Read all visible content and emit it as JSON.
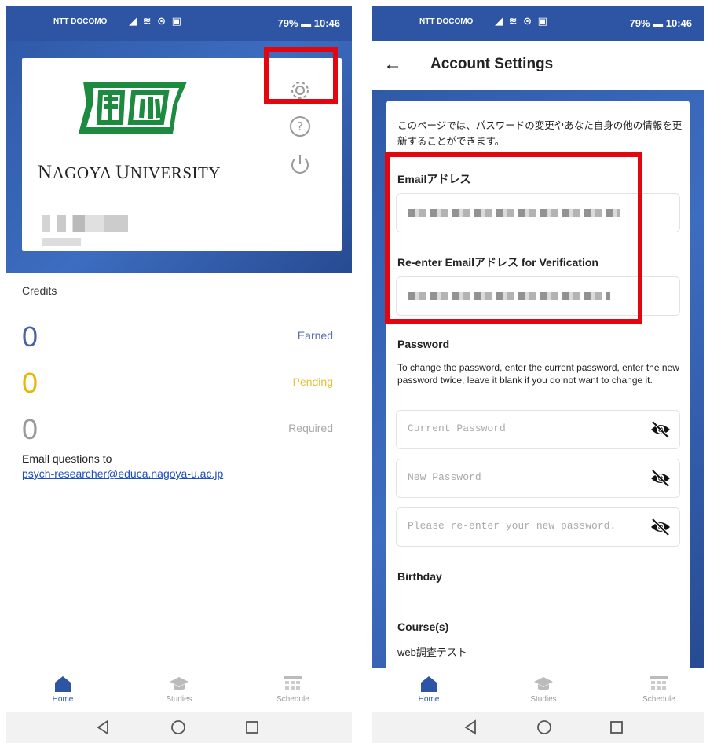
{
  "status_bar": {
    "carrier": "NTT DOCOMO",
    "battery": "79%",
    "time": "10:46"
  },
  "home": {
    "university_name_cap1": "N",
    "university_name_rest1": "AGOYA ",
    "university_name_cap2": "U",
    "university_name_rest2": "NIVERSITY",
    "credits_title": "Credits",
    "credits": [
      {
        "value": "0",
        "label": "Earned",
        "color": "#4a63a8",
        "label_color": "#5871b0"
      },
      {
        "value": "0",
        "label": "Pending",
        "color": "#e6b800",
        "label_color": "#e8be34"
      },
      {
        "value": "0",
        "label": "Required",
        "color": "#9a9a9a",
        "label_color": "#a9a9a9"
      }
    ],
    "email_questions": "Email questions to",
    "email_link": "psych-researcher@educa.nagoya-u.ac.jp",
    "icons": [
      "gear-icon",
      "help-icon",
      "power-icon"
    ]
  },
  "settings": {
    "title": "Account Settings",
    "intro": "このページでは、パスワードの変更やあなた自身の他の情報を更新することができます。",
    "email_label": "Emailアドレス",
    "reenter_email_label": "Re-enter Emailアドレス for Verification",
    "password_label": "Password",
    "password_help": "To change the password, enter the current password, enter the new password twice, leave it blank if you do not want to change it.",
    "current_password_placeholder": "Current Password",
    "new_password_placeholder": "New Password",
    "confirm_password_placeholder": "Please re-enter your new password.",
    "birthday_label": "Birthday",
    "courses_label": "Course(s)",
    "course_value": "web調査テスト"
  },
  "bottom_nav": [
    {
      "label": "Home",
      "icon": "home-icon",
      "active": true
    },
    {
      "label": "Studies",
      "icon": "graduation-cap-icon",
      "active": false
    },
    {
      "label": "Schedule",
      "icon": "calendar-grid-icon",
      "active": false
    }
  ],
  "colors": {
    "brand_blue": "#2d55a3",
    "highlight_red": "#e4060f",
    "logo_green": "#1c8a3f"
  }
}
